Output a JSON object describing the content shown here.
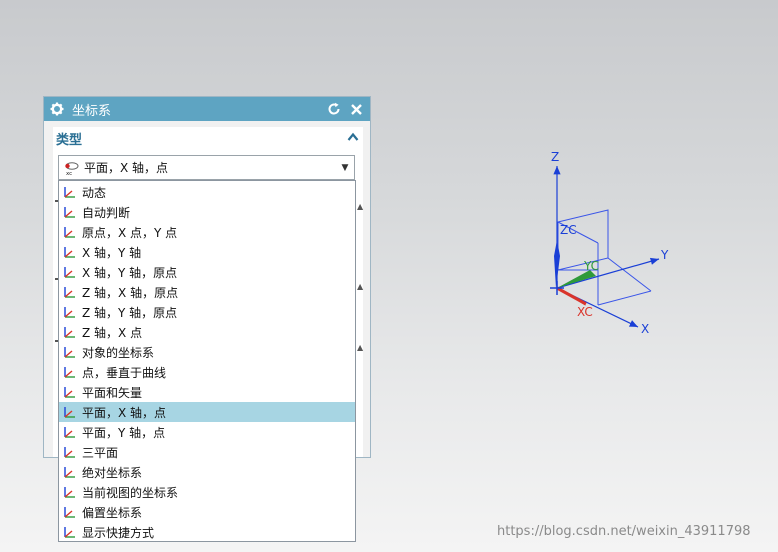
{
  "dialog": {
    "title": "坐标系",
    "section_label": "类型",
    "selected_value": "平面，X 轴，点"
  },
  "dropdown_items": [
    {
      "label": "动态",
      "icon": "dynamic-csys-icon",
      "selected": false
    },
    {
      "label": "自动判断",
      "icon": "inferred-csys-icon",
      "selected": false
    },
    {
      "label": "原点，X 点，Y 点",
      "icon": "origin-xpoint-ypoint-icon",
      "selected": false
    },
    {
      "label": "X 轴，Y 轴",
      "icon": "xaxis-yaxis-icon",
      "selected": false
    },
    {
      "label": "X 轴，Y 轴，原点",
      "icon": "xaxis-yaxis-origin-icon",
      "selected": false
    },
    {
      "label": "Z 轴，X 轴，原点",
      "icon": "zaxis-xaxis-origin-icon",
      "selected": false
    },
    {
      "label": "Z 轴，Y 轴，原点",
      "icon": "zaxis-yaxis-origin-icon",
      "selected": false
    },
    {
      "label": "Z 轴，X 点",
      "icon": "zaxis-xpoint-icon",
      "selected": false
    },
    {
      "label": "对象的坐标系",
      "icon": "csys-of-object-icon",
      "selected": false
    },
    {
      "label": "点，垂直于曲线",
      "icon": "point-normal-to-curve-icon",
      "selected": false
    },
    {
      "label": "平面和矢量",
      "icon": "plane-and-vector-icon",
      "selected": false
    },
    {
      "label": "平面，X 轴，点",
      "icon": "plane-xaxis-point-icon",
      "selected": true
    },
    {
      "label": "平面，Y 轴，点",
      "icon": "plane-yaxis-point-icon",
      "selected": false
    },
    {
      "label": "三平面",
      "icon": "three-planes-icon",
      "selected": false
    },
    {
      "label": "绝对坐标系",
      "icon": "absolute-csys-icon",
      "selected": false
    },
    {
      "label": "当前视图的坐标系",
      "icon": "current-view-csys-icon",
      "selected": false
    },
    {
      "label": "偏置坐标系",
      "icon": "offset-csys-icon",
      "selected": false
    },
    {
      "label": "显示快捷方式",
      "icon": "show-shortcuts-icon",
      "selected": false
    }
  ],
  "viewport": {
    "axis_labels": {
      "z": "Z",
      "y": "Y",
      "x": "X",
      "zc": "ZC",
      "yc": "YC",
      "xc": "XC"
    }
  },
  "watermark": "https://blog.csdn.net/weixin_43911798",
  "colors": {
    "title_bar": "#5ea4c2",
    "selected_row": "#a7d5e3",
    "axis_blue": "#1a3fd6",
    "xc_red": "#d9342b",
    "yc_green": "#2f9a3a"
  }
}
